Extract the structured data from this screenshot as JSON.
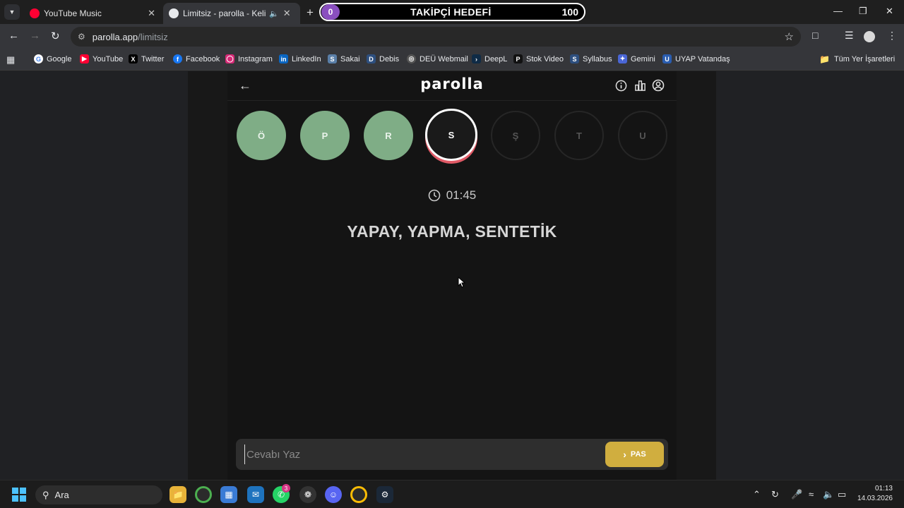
{
  "browser": {
    "tabs": [
      {
        "title": "YouTube Music",
        "color": "#ff0033"
      },
      {
        "title": "Limitsiz - parolla - Kelime oyunu",
        "color": "#e8eaed"
      }
    ],
    "follow_widget": {
      "count": "0",
      "title": "TAKİPÇİ HEDEFİ",
      "goal": "100"
    },
    "url_host": "parolla.app",
    "url_path": "/limitsiz",
    "bookmarks": [
      "Google",
      "YouTube",
      "Twitter",
      "Facebook",
      "Instagram",
      "LinkedIn",
      "Sakai",
      "Debis",
      "DEÜ Webmail",
      "DeepL",
      "Stok Video",
      "Syllabus",
      "Gemini",
      "UYAP Vatandaş"
    ],
    "all_bookmarks": "Tüm Yer İşaretleri"
  },
  "app": {
    "logo": "parolla",
    "letters": [
      {
        "char": "Ö",
        "state": "done"
      },
      {
        "char": "P",
        "state": "done"
      },
      {
        "char": "R",
        "state": "done"
      },
      {
        "char": "S",
        "state": "current"
      },
      {
        "char": "Ş",
        "state": "pending"
      },
      {
        "char": "T",
        "state": "pending"
      },
      {
        "char": "U",
        "state": "pending"
      }
    ],
    "timer": "01:45",
    "question": "YAPAY, YAPMA, SENTETİK",
    "answer_placeholder": "Cevabı Yaz",
    "pass_label": "PAS",
    "colors": {
      "done": "#7fad86",
      "current_ring": "#e05a66",
      "pass": "#d0ae3f"
    }
  },
  "taskbar": {
    "search_label": "Ara",
    "whatsapp_badge": "3",
    "time": "01:13",
    "date": "14.03.2026"
  }
}
